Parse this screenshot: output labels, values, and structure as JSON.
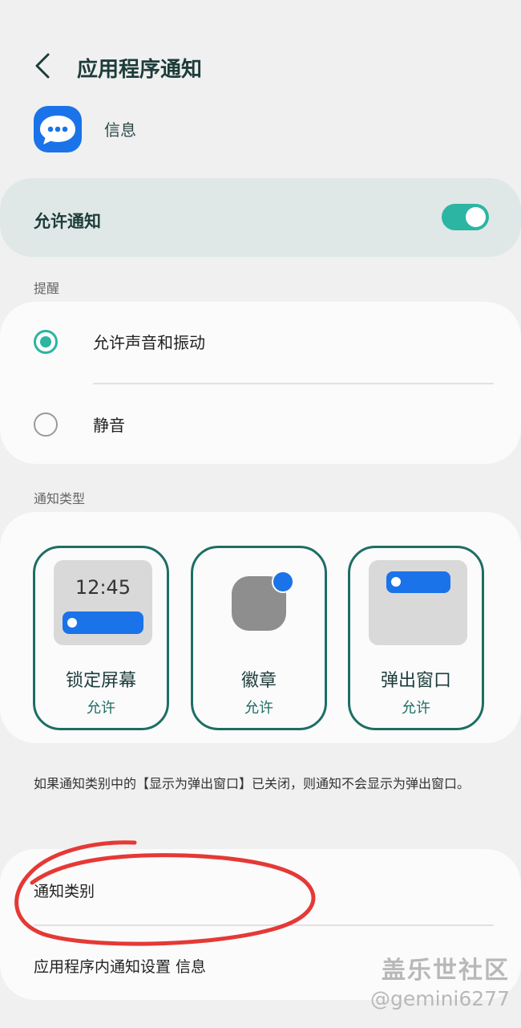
{
  "header": {
    "title": "应用程序通知"
  },
  "app": {
    "name": "信息"
  },
  "allow": {
    "label": "允许通知",
    "enabled": true
  },
  "alerts": {
    "section": "提醒",
    "options": [
      {
        "label": "允许声音和振动",
        "selected": true
      },
      {
        "label": "静音",
        "selected": false
      }
    ]
  },
  "types": {
    "section": "通知类型",
    "items": [
      {
        "label": "锁定屏幕",
        "state": "允许",
        "preview_time": "12:45"
      },
      {
        "label": "徽章",
        "state": "允许"
      },
      {
        "label": "弹出窗口",
        "state": "允许"
      }
    ],
    "note": "如果通知类别中的【显示为弹出窗口】已关闭，则通知不会显示为弹出窗口。"
  },
  "links": {
    "categories": "通知类别",
    "in_app": "应用程序内通知设置 信息"
  },
  "watermark": {
    "brand": "盖乐世社区",
    "user": "@gemini6277"
  },
  "colors": {
    "accent": "#2bb5a2",
    "dark_teal": "#1e6e64",
    "blue": "#1a73e8",
    "annotation": "#e53935"
  }
}
